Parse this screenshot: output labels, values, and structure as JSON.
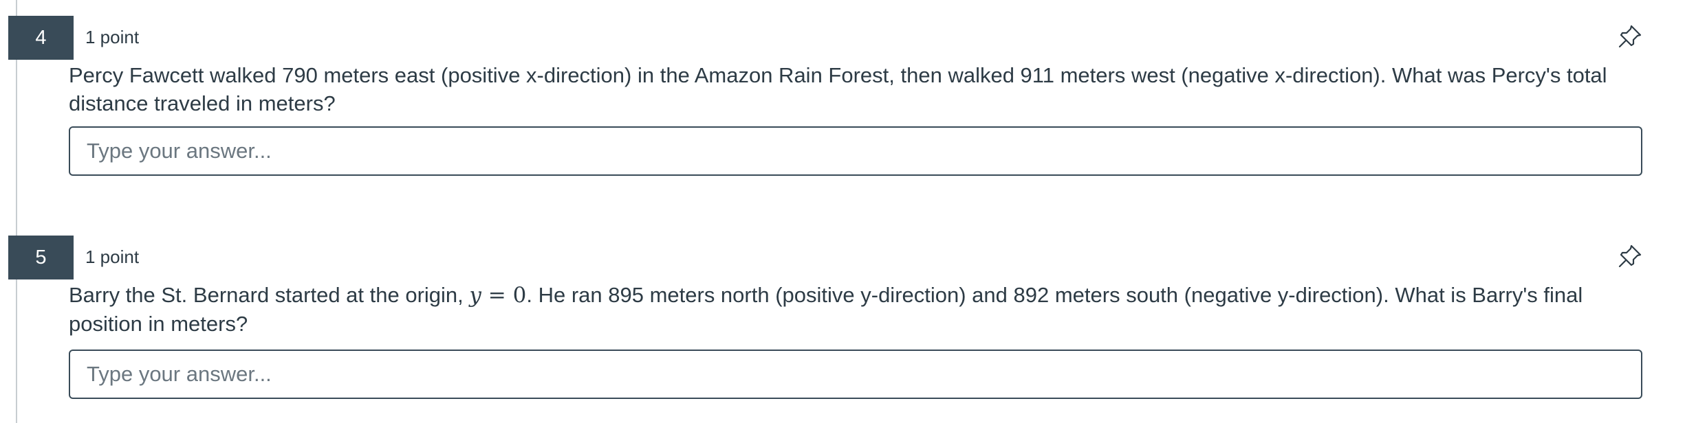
{
  "questions": [
    {
      "number": "4",
      "points": "1 point",
      "prompt": "Percy Fawcett walked 790 meters east (positive x-direction) in the Amazon Rain Forest, then walked 911 meters west (negative x-direction).  What was Percy's total distance traveled in meters?",
      "answer_placeholder": "Type your answer...",
      "answer_value": "",
      "icon": "pin-icon"
    },
    {
      "number": "5",
      "points": "1 point",
      "prompt_before_math": "Barry the St. Bernard started at the origin, ",
      "math": {
        "variable": "y",
        "operator": "=",
        "value": "0"
      },
      "prompt_after_math": ".  He ran 895 meters north (positive y-direction) and 892 meters south (negative y-direction).  What is Barry's final position in meters?",
      "answer_placeholder": "Type your answer...",
      "answer_value": "",
      "icon": "pin-icon"
    }
  ],
  "colors": {
    "badge_bg": "#394b58",
    "text": "#2d3b45",
    "border": "#394b58"
  }
}
